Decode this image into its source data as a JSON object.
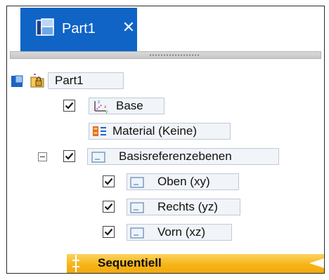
{
  "tab": {
    "title": "Part1",
    "close_glyph": "✕",
    "icon": "part-document-icon",
    "bg_color": "#0f64c6"
  },
  "tree": {
    "root": {
      "label": "Part1",
      "icons": [
        "part-icon",
        "lock-folder-icon"
      ]
    },
    "base": {
      "label": "Base",
      "checked": true,
      "icon": "coordinate-system-icon"
    },
    "material": {
      "label": "Material (Keine)",
      "icon": "material-icon"
    },
    "refplanes": {
      "label": "Basisreferenzebenen",
      "checked": true,
      "expanded": true,
      "icon": "reference-plane-icon",
      "children": [
        {
          "label": "Oben (xy)",
          "checked": true,
          "icon": "reference-plane-icon"
        },
        {
          "label": "Rechts (yz)",
          "checked": true,
          "icon": "reference-plane-icon"
        },
        {
          "label": "Vorn (xz)",
          "checked": true,
          "icon": "reference-plane-icon"
        }
      ]
    },
    "sequential": {
      "label": "Sequentiell",
      "color": "#f6b519"
    }
  }
}
